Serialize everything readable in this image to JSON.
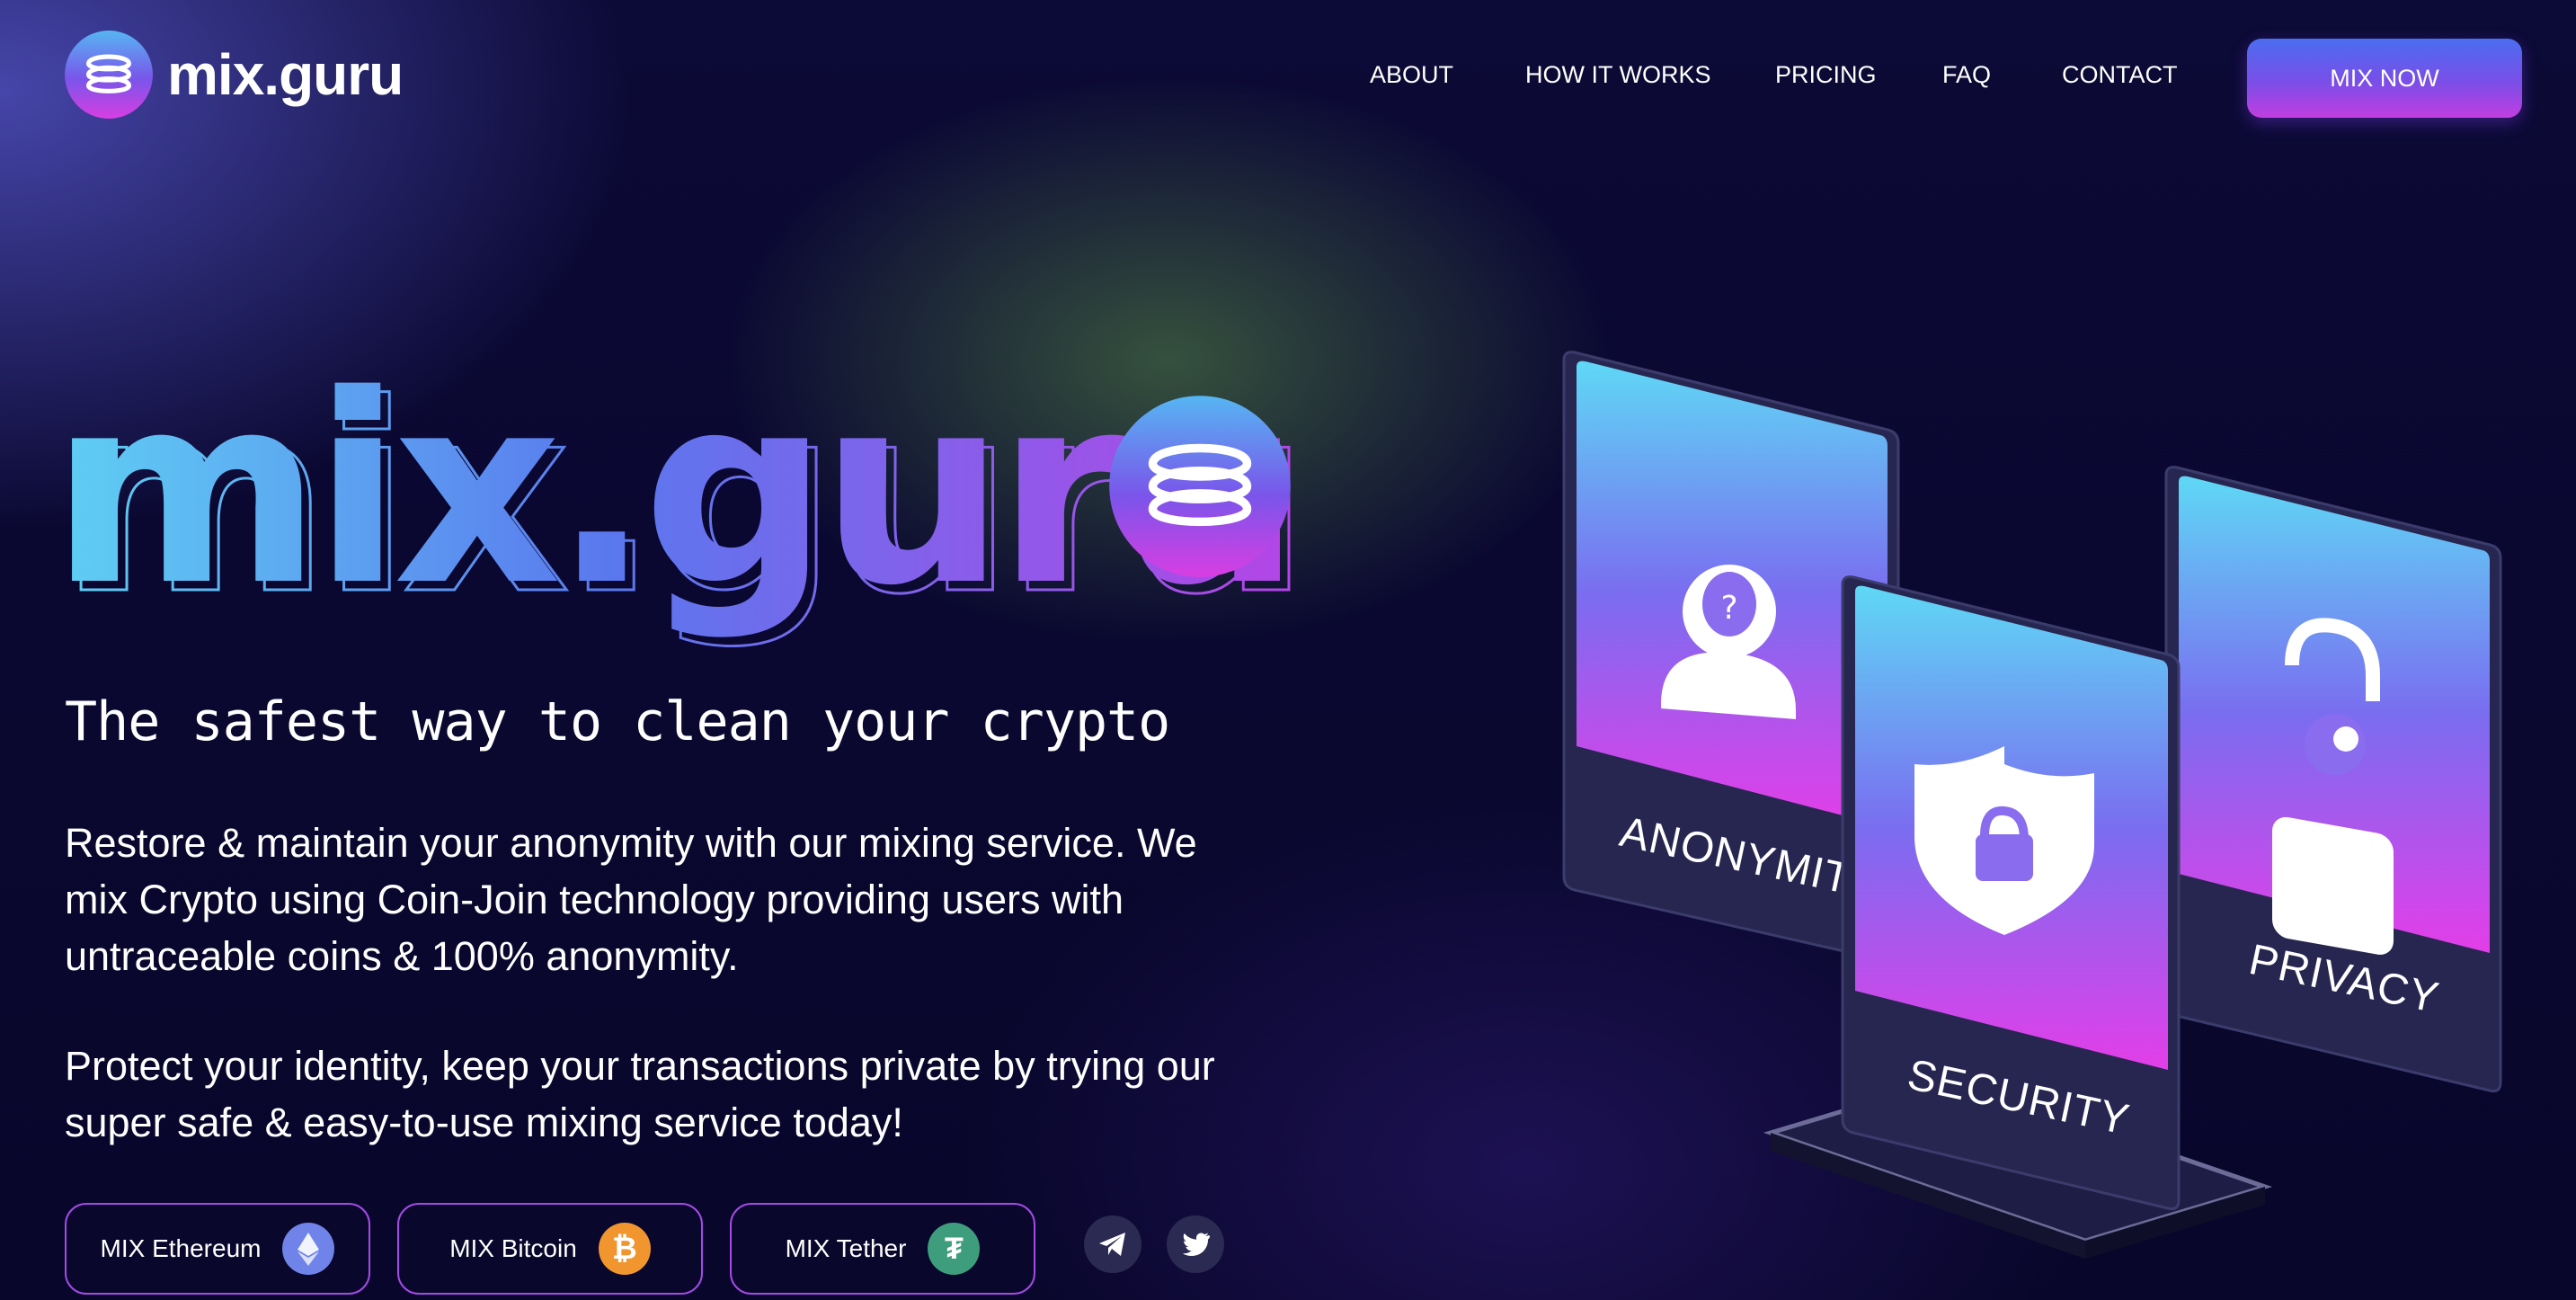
{
  "header": {
    "logo_text": "mix.guru",
    "nav": [
      "ABOUT",
      "HOW IT WORKS",
      "PRICING",
      "FAQ",
      "CONTACT"
    ],
    "cta_label": "MIX NOW"
  },
  "hero": {
    "title": "mix.guru",
    "tagline": "The safest way to clean your crypto",
    "paragraph1": "Restore & maintain your anonymity with our mixing service. We mix Crypto using Coin-Join technology providing users with untraceable coins & 100% anonymity.",
    "paragraph2": "Protect your identity, keep your transactions private by trying our super safe & easy-to-use mixing service today!"
  },
  "buttons": [
    {
      "label": "MIX Ethereum",
      "icon": "ethereum-icon",
      "color": "#6f83e8"
    },
    {
      "label": "MIX Bitcoin",
      "icon": "bitcoin-icon",
      "color": "#f1962f"
    },
    {
      "label": "MIX Tether",
      "icon": "tether-icon",
      "color": "#3e9d7c"
    }
  ],
  "social": [
    "telegram-icon",
    "twitter-icon"
  ],
  "cards": [
    "ANONYMITY",
    "SECURITY",
    "PRIVACY"
  ],
  "colors": {
    "background": "#0a0830",
    "accent_blue": "#4a6ef0",
    "accent_magenta": "#c23ee0",
    "card_top": "#5fd8f5",
    "card_bottom": "#e33ee8"
  }
}
